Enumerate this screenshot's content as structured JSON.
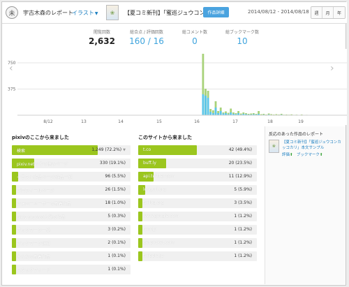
{
  "header": {
    "logo_glyph": "未",
    "report_title": "宇古木森のレポート",
    "type_label": "イラスト",
    "thumbnail_icon": "artwork-thumbnail",
    "work_title": "【夏コミ新刊】「蜜巡ジュウコン…",
    "work_detail_label": "作品詳細",
    "date_range": "2014/08/12 - 2014/08/18",
    "periods": [
      "週",
      "月",
      "年"
    ]
  },
  "stats": [
    {
      "label": "閲覧回数",
      "value": "2,632"
    },
    {
      "label": "総合点 / 評価回数",
      "value": "160 / 16"
    },
    {
      "label": "総コメント数",
      "value": "0"
    },
    {
      "label": "総ブックマーク数",
      "value": "10"
    }
  ],
  "chart_data": {
    "type": "bar",
    "y_tick_labels": [
      "750",
      "375"
    ],
    "x_tick_labels": [
      "8/12",
      "13",
      "14",
      "15",
      "16",
      "17",
      "18",
      "19"
    ],
    "ylim": [
      0,
      900
    ],
    "colors": {
      "views_total": "#a8d27a",
      "views_highlight": "#5cc6ea"
    },
    "nav": {
      "prev": "‹",
      "next": "›"
    },
    "series": [
      {
        "values": [
          0,
          0,
          0,
          0,
          0,
          0,
          0,
          0,
          0,
          0,
          0,
          0,
          0,
          0,
          0,
          0,
          0,
          0,
          0,
          0,
          0,
          0,
          0,
          0,
          0,
          0,
          0,
          0,
          0,
          0,
          0,
          0,
          0,
          0,
          0,
          0,
          0,
          0,
          0,
          0,
          0,
          0,
          0,
          0,
          0,
          0,
          0,
          0,
          0,
          0,
          0,
          0,
          0,
          0,
          0,
          0,
          0,
          0,
          0,
          0,
          0,
          0,
          0,
          0,
          0,
          0,
          0,
          0,
          0,
          0,
          0,
          0,
          0,
          880,
          380,
          350,
          90,
          70,
          200,
          60,
          110,
          40,
          55,
          35,
          95,
          40,
          30,
          60,
          25,
          40,
          30,
          20,
          25,
          30,
          20,
          60,
          15,
          20,
          10,
          25,
          15,
          10,
          15,
          10,
          20,
          8,
          10,
          8,
          12,
          6,
          8,
          5,
          10,
          4,
          6,
          3,
          5,
          2,
          3,
          2,
          2,
          1
        ]
      },
      {
        "values": [
          0,
          0,
          0,
          0,
          0,
          0,
          0,
          0,
          0,
          0,
          0,
          0,
          0,
          0,
          0,
          0,
          0,
          0,
          0,
          0,
          0,
          0,
          0,
          0,
          0,
          0,
          0,
          0,
          0,
          0,
          0,
          0,
          0,
          0,
          0,
          0,
          0,
          0,
          0,
          0,
          0,
          0,
          0,
          0,
          0,
          0,
          0,
          0,
          0,
          0,
          0,
          0,
          0,
          0,
          0,
          0,
          0,
          0,
          0,
          0,
          0,
          0,
          0,
          0,
          0,
          0,
          0,
          0,
          0,
          0,
          0,
          0,
          0,
          300,
          280,
          250,
          50,
          30,
          110,
          30,
          60,
          25,
          30,
          15,
          40,
          20,
          15,
          30,
          10,
          20,
          15,
          10,
          10,
          15,
          10,
          20,
          5,
          8,
          4,
          10,
          5,
          3,
          5,
          3,
          8,
          3,
          4,
          3,
          4,
          2,
          3,
          2,
          3,
          1,
          2,
          1,
          2,
          1,
          1,
          1,
          1,
          0
        ]
      }
    ]
  },
  "sources_internal": {
    "title": "pixivのここから来ました",
    "items": [
      {
        "name": "検索",
        "count": "1,249 (72.2%)",
        "ratio": 0.722
      },
      {
        "name": "pixiv.netのその他のページ",
        "count": "330 (19.1%)",
        "ratio": 0.191
      },
      {
        "name": "イラスト作品ページ/作品一覧",
        "count": "96 (5.5%)",
        "ratio": 0.055
      },
      {
        "name": "プロフィールページ",
        "count": "26 (1.5%)",
        "ratio": 0.015
      },
      {
        "name": "フォローユーザーの新着作品",
        "count": "18 (1.0%)",
        "ratio": 0.01
      },
      {
        "name": "pixiv touchの人気の作品",
        "count": "5 (0.3%)",
        "ratio": 0.003
      },
      {
        "name": "ブックマーク一覧",
        "count": "3 (0.2%)",
        "ratio": 0.002
      },
      {
        "name": "ブックマーク詳細",
        "count": "2 (0.1%)",
        "ratio": 0.001
      },
      {
        "name": "みんなの新着作品",
        "count": "1 (0.1%)",
        "ratio": 0.001
      },
      {
        "name": "スタックフィード",
        "count": "1 (0.1%)",
        "ratio": 0.001
      }
    ]
  },
  "sources_external": {
    "title": "このサイトから来ました",
    "items": [
      {
        "name": "t.co",
        "count": "42 (49.4%)",
        "ratio": 0.494
      },
      {
        "name": "buff.ly",
        "count": "20 (23.5%)",
        "ratio": 0.235
      },
      {
        "name": "api.twitter.com",
        "count": "11 (12.9%)",
        "ratio": 0.129
      },
      {
        "name": "longurl.org",
        "count": "5 (5.9%)",
        "ratio": 0.059
      },
      {
        "name": "twilog.org",
        "count": "3 (3.5%)",
        "ratio": 0.035
      },
      {
        "name": "www.google.com",
        "count": "1 (1.2%)",
        "ratio": 0.012
      },
      {
        "name": "twtr.jp",
        "count": "1 (1.2%)",
        "ratio": 0.012
      },
      {
        "name": "getpocket.com",
        "count": "1 (1.2%)",
        "ratio": 0.012
      },
      {
        "name": "twipple.jp",
        "count": "1 (1.2%)",
        "ratio": 0.012
      }
    ]
  },
  "reaction_panel": {
    "title": "反応のあった作品のレポート",
    "thumbnail_icon": "artwork-thumbnail",
    "work_text": "【夏コミ新刊】「蜜巡ジュウコンカッコカリ」本文サンプル",
    "eval_label": "評価",
    "bookmark_label": "ブックマーク",
    "up_arrow": "⬆"
  }
}
